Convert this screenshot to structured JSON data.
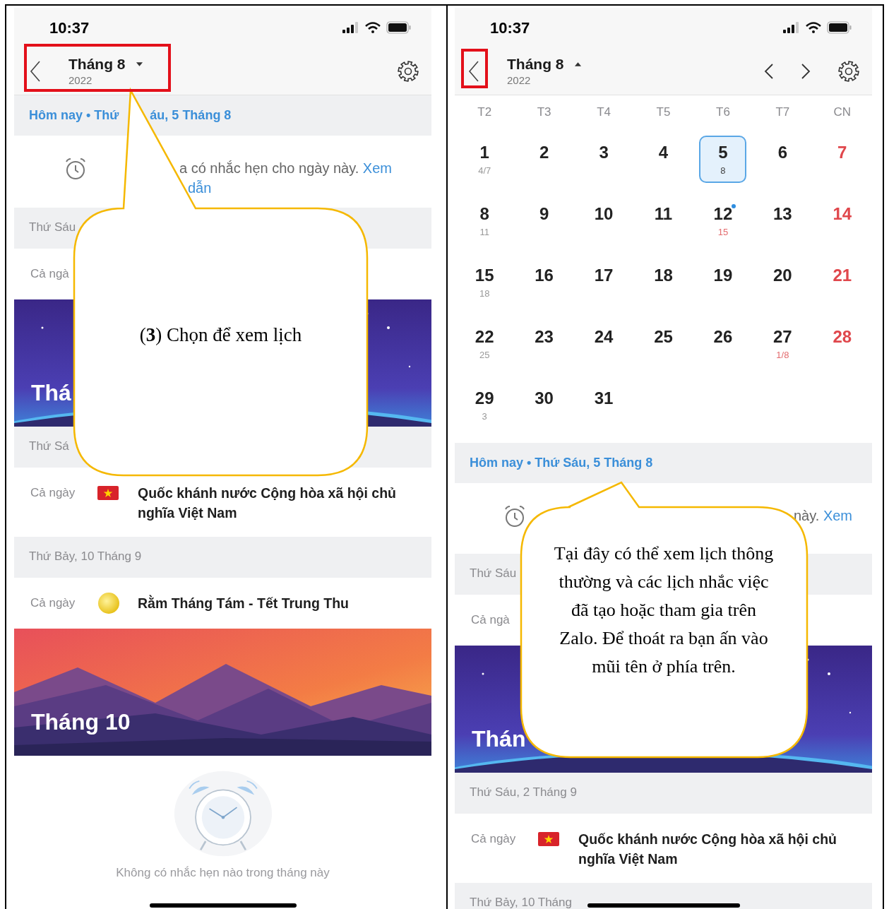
{
  "left_screen": {
    "status_bar": {
      "time": "10:37"
    },
    "header": {
      "month": "Tháng 8",
      "year": "2022",
      "expanded": false
    },
    "today_bar": {
      "parts": [
        "Hôm nay • Thứ",
        "áu, 5 Tháng 8"
      ]
    },
    "reminder": {
      "text": "a có nhắc hẹn cho ngày này.",
      "link": "Xem",
      "link_line2": "dẫn"
    },
    "agenda": [
      {
        "kind": "date_header",
        "text": "Thứ Sáu"
      },
      {
        "kind": "event",
        "time": "Cả ngà"
      },
      {
        "kind": "night_banner",
        "text": "Thá"
      },
      {
        "kind": "date_header",
        "text": "Thứ Sá"
      },
      {
        "kind": "flag_event",
        "time": "Cả ngày",
        "title": "Quốc khánh nước Cộng hòa xã hội chủ nghĩa Việt Nam"
      },
      {
        "kind": "date_header",
        "text": "Thứ Bảy, 10 Tháng 9"
      },
      {
        "kind": "moon_event",
        "time": "Cả ngày",
        "title": "Rằm Tháng Tám - Tết Trung Thu"
      },
      {
        "kind": "sunset_banner",
        "text": "Tháng 10"
      },
      {
        "kind": "empty",
        "text": "Không có nhắc hẹn nào trong tháng này"
      }
    ]
  },
  "right_screen": {
    "status_bar": {
      "time": "10:37"
    },
    "header": {
      "month": "Tháng 8",
      "year": "2022",
      "expanded": true
    },
    "weekdays": [
      "T2",
      "T3",
      "T4",
      "T5",
      "T6",
      "T7",
      "CN"
    ],
    "days": [
      {
        "day": "1",
        "lunar": "4/7",
        "red": false,
        "lunar_red": false,
        "selected": false,
        "dot": false
      },
      {
        "day": "2",
        "red": false,
        "selected": false,
        "dot": false
      },
      {
        "day": "3",
        "red": false,
        "selected": false,
        "dot": false
      },
      {
        "day": "4",
        "red": false,
        "selected": false,
        "dot": false
      },
      {
        "day": "5",
        "lunar": "8",
        "red": false,
        "lunar_red": false,
        "selected": true,
        "dot": false
      },
      {
        "day": "6",
        "red": false,
        "selected": false,
        "dot": false
      },
      {
        "day": "7",
        "red": true,
        "selected": false,
        "dot": false
      },
      {
        "day": "8",
        "lunar": "11",
        "red": false,
        "lunar_red": false,
        "selected": false,
        "dot": false
      },
      {
        "day": "9",
        "red": false,
        "selected": false,
        "dot": false
      },
      {
        "day": "10",
        "red": false,
        "selected": false,
        "dot": false
      },
      {
        "day": "11",
        "red": false,
        "selected": false,
        "dot": false
      },
      {
        "day": "12",
        "lunar": "15",
        "red": false,
        "lunar_red": true,
        "selected": false,
        "dot": true
      },
      {
        "day": "13",
        "red": false,
        "selected": false,
        "dot": false
      },
      {
        "day": "14",
        "red": true,
        "selected": false,
        "dot": false
      },
      {
        "day": "15",
        "lunar": "18",
        "red": false,
        "lunar_red": false,
        "selected": false,
        "dot": false
      },
      {
        "day": "16",
        "red": false,
        "selected": false,
        "dot": false
      },
      {
        "day": "17",
        "red": false,
        "selected": false,
        "dot": false
      },
      {
        "day": "18",
        "red": false,
        "selected": false,
        "dot": false
      },
      {
        "day": "19",
        "red": false,
        "selected": false,
        "dot": false
      },
      {
        "day": "20",
        "red": false,
        "selected": false,
        "dot": false
      },
      {
        "day": "21",
        "red": true,
        "selected": false,
        "dot": false
      },
      {
        "day": "22",
        "lunar": "25",
        "red": false,
        "lunar_red": false,
        "selected": false,
        "dot": false
      },
      {
        "day": "23",
        "red": false,
        "selected": false,
        "dot": false
      },
      {
        "day": "24",
        "red": false,
        "selected": false,
        "dot": false
      },
      {
        "day": "25",
        "red": false,
        "selected": false,
        "dot": false
      },
      {
        "day": "26",
        "red": false,
        "selected": false,
        "dot": false
      },
      {
        "day": "27",
        "lunar": "1/8",
        "red": false,
        "lunar_red": true,
        "selected": false,
        "dot": false
      },
      {
        "day": "28",
        "red": true,
        "selected": false,
        "dot": false
      },
      {
        "day": "29",
        "lunar": "3",
        "red": false,
        "lunar_red": false,
        "selected": false,
        "dot": false
      },
      {
        "day": "30",
        "red": false,
        "selected": false,
        "dot": false
      },
      {
        "day": "31",
        "red": false,
        "selected": false,
        "dot": false
      }
    ],
    "today_bar": {
      "parts": [
        "Hôm nay • Thứ Sáu, 5 Tháng 8"
      ]
    },
    "reminder": {
      "text": "này.",
      "link": "Xem"
    },
    "agenda": [
      {
        "kind": "date_header",
        "text": "Thứ Sáu"
      },
      {
        "kind": "event",
        "time": "Cả ngà"
      },
      {
        "kind": "night_banner",
        "text": "Thán"
      },
      {
        "kind": "date_header",
        "text": "Thứ Sáu, 2 Tháng 9"
      },
      {
        "kind": "flag_event",
        "time": "Cả ngày",
        "title": "Quốc khánh nước Cộng hòa xã hội chủ nghĩa Việt Nam"
      },
      {
        "kind": "date_header",
        "text": "Thứ Bảy, 10 Tháng"
      }
    ]
  },
  "callouts": [
    {
      "text": "(**3**) Chọn để xem lịch"
    },
    {
      "text": "Tại đây có thể xem lịch thông thường và các lịch nhắc việc đã tạo hoặc tham gia trên Zalo. Để thoát ra bạn ấn vào mũi tên ở phía trên."
    }
  ]
}
